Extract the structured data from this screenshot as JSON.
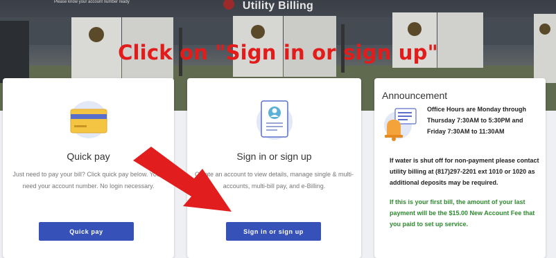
{
  "hero": {
    "title": "Utility Billing",
    "top_fragment": "Please know your account number ready"
  },
  "annotation": {
    "text": "Click on \"Sign in or sign up\""
  },
  "cards": {
    "quick_pay": {
      "icon": "credit-card-icon",
      "title": "Quick pay",
      "description": "Just need to pay your bill? Click quick pay below. You'll need your account number. No login necessary.",
      "button": "Quick pay"
    },
    "sign_in": {
      "icon": "profile-document-icon",
      "title": "Sign in or sign up",
      "description": "Create an account to view details, manage single & multi-accounts, multi-bill pay, and e-Billing.",
      "button": "Sign in or sign up"
    },
    "announcement": {
      "icon": "bell-announcement-icon",
      "title": "Announcement",
      "office_hours": "Office Hours are Monday through Thursday 7:30AM to 5:30PM and Friday 7:30AM to 11:30AM",
      "shutoff_notice": "If water is shut off for non-payment please contact utility billing at (817)297-2201 ext 1010 or 1020 as additional deposits may be required.",
      "first_bill_notice": "If this is your first bill, the amount of your last payment will be the $15.00 New Account Fee that you paid to set up service."
    }
  },
  "colors": {
    "button": "#3652b8",
    "annotation_red": "#e21b1b",
    "notice_green": "#2e8a2e"
  }
}
